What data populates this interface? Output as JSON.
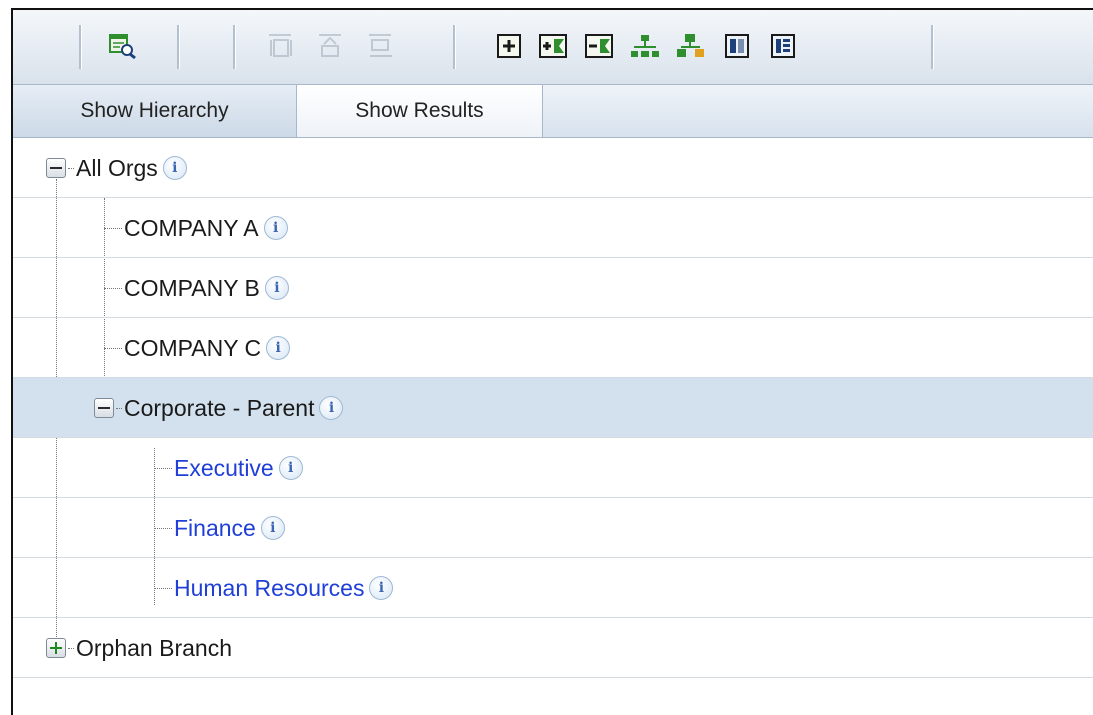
{
  "toolbar": {
    "buttons": [
      {
        "name": "view-details-icon",
        "enabled": true
      },
      {
        "name": "move-top-icon",
        "enabled": false
      },
      {
        "name": "move-up-icon",
        "enabled": false
      },
      {
        "name": "move-bottom-icon",
        "enabled": false
      },
      {
        "name": "add-node-icon",
        "enabled": true
      },
      {
        "name": "expand-all-icon",
        "enabled": true
      },
      {
        "name": "collapse-all-icon",
        "enabled": true
      },
      {
        "name": "hierarchy-icon",
        "enabled": true
      },
      {
        "name": "org-chart-icon",
        "enabled": true
      },
      {
        "name": "columns-icon",
        "enabled": true
      },
      {
        "name": "table-icon",
        "enabled": true
      }
    ]
  },
  "tabs": [
    {
      "label": "Show Hierarchy",
      "active": true
    },
    {
      "label": "Show Results",
      "active": false
    }
  ],
  "tree": {
    "nodes": [
      {
        "label": "All Orgs",
        "level": 0,
        "expander": "minus",
        "selected": false,
        "link": false
      },
      {
        "label": "COMPANY A",
        "level": 1,
        "expander": "none",
        "selected": false,
        "link": false
      },
      {
        "label": "COMPANY B",
        "level": 1,
        "expander": "none",
        "selected": false,
        "link": false
      },
      {
        "label": "COMPANY C",
        "level": 1,
        "expander": "none",
        "selected": false,
        "link": false
      },
      {
        "label": "Corporate - Parent",
        "level": 1,
        "expander": "minus",
        "selected": true,
        "link": false
      },
      {
        "label": "Executive",
        "level": 2,
        "expander": "none",
        "selected": false,
        "link": true
      },
      {
        "label": "Finance",
        "level": 2,
        "expander": "none",
        "selected": false,
        "link": true
      },
      {
        "label": "Human Resources",
        "level": 2,
        "expander": "none",
        "selected": false,
        "link": true
      },
      {
        "label": "Orphan Branch",
        "level": 0,
        "expander": "plus",
        "selected": false,
        "link": false
      }
    ]
  },
  "colors": {
    "link": "#1f3fd6",
    "selected_row": "#d3e1ee",
    "toolbar_icon_green": "#2f8f2f"
  }
}
